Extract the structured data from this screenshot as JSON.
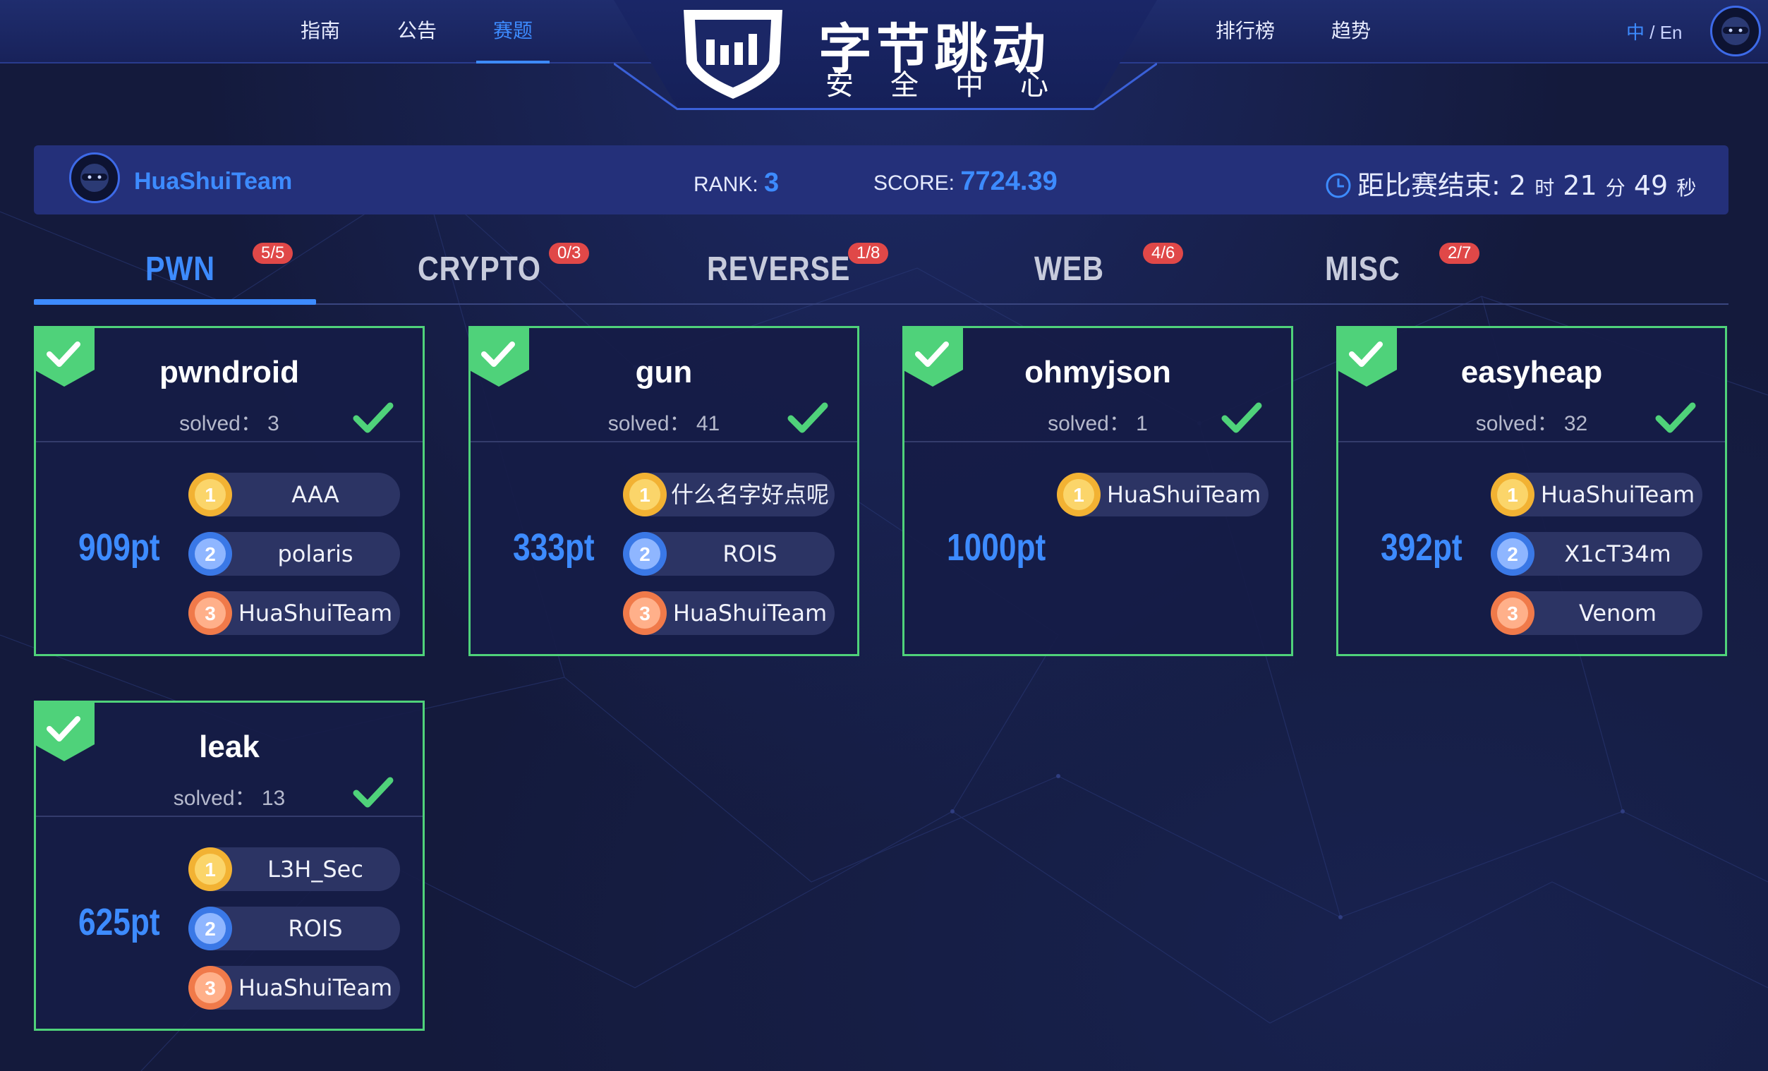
{
  "nav": {
    "items": [
      {
        "label": "指南"
      },
      {
        "label": "公告"
      },
      {
        "label": "赛题",
        "active": true
      },
      {
        "label": "排行榜"
      },
      {
        "label": "趋势"
      }
    ],
    "lang_zh": "中",
    "lang_sep": " / ",
    "lang_en": "En"
  },
  "logo": {
    "title": "字节跳动",
    "subtitle": "安全中心"
  },
  "status": {
    "team": "HuaShuiTeam",
    "rank_label": "RANK:",
    "rank": "3",
    "score_label": "SCORE:",
    "score": "7724.39",
    "countdown_label": "距比赛结束:",
    "hours": "2",
    "hours_unit": "时",
    "minutes": "21",
    "minutes_unit": "分",
    "seconds": "49",
    "seconds_unit": "秒"
  },
  "tabs": [
    {
      "label": "PWN",
      "badge": "5/5",
      "active": true
    },
    {
      "label": "CRYPTO",
      "badge": "0/3"
    },
    {
      "label": "REVERSE",
      "badge": "1/8"
    },
    {
      "label": "WEB",
      "badge": "4/6"
    },
    {
      "label": "MISC",
      "badge": "2/7"
    }
  ],
  "cards": [
    {
      "name": "pwndroid",
      "solved": "solved：  3",
      "points": "909pt",
      "solvers": [
        "AAA",
        "polaris",
        "HuaShuiTeam"
      ]
    },
    {
      "name": "gun",
      "solved": "solved：  41",
      "points": "333pt",
      "solvers": [
        "什么名字好点呢",
        "ROIS",
        "HuaShuiTeam"
      ]
    },
    {
      "name": "ohmyjson",
      "solved": "solved：  1",
      "points": "1000pt",
      "solvers": [
        "HuaShuiTeam"
      ]
    },
    {
      "name": "easyheap",
      "solved": "solved：  32",
      "points": "392pt",
      "solvers": [
        "HuaShuiTeam",
        "X1cT34m",
        "Venom"
      ]
    },
    {
      "name": "leak",
      "solved": "solved：  13",
      "points": "625pt",
      "solvers": [
        "L3H_Sec",
        "ROIS",
        "HuaShuiTeam"
      ]
    }
  ],
  "colors": {
    "accent": "#3d8bff",
    "solved_border": "#4fd27a",
    "badge": "#e04848",
    "gold": "#f2b233",
    "silver": "#3a78e6",
    "bronze": "#f07a4a"
  }
}
